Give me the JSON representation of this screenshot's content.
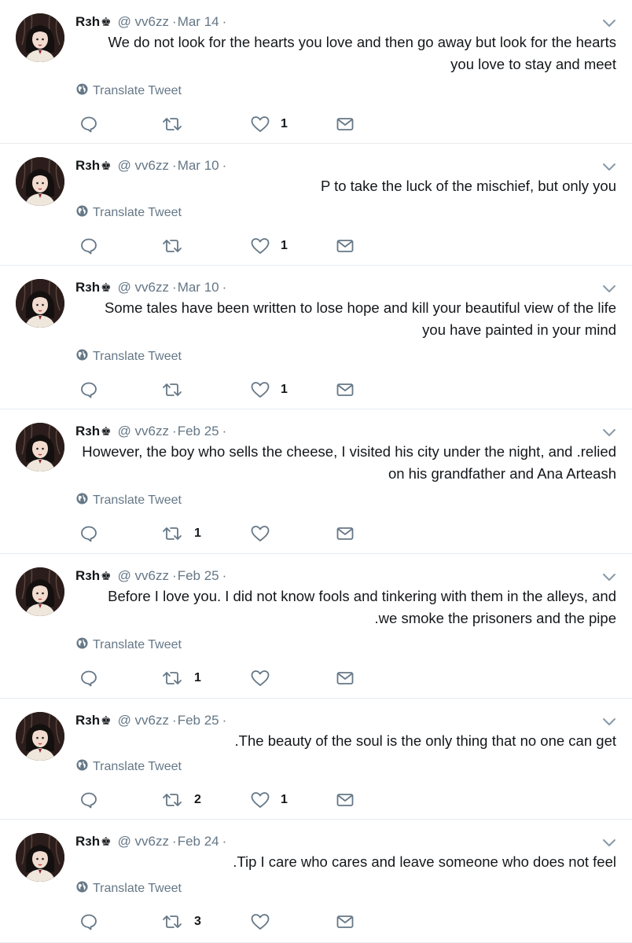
{
  "tweets": [
    {
      "name": "Rɜh",
      "handle": "@ vv6zz",
      "date": "Mar 14",
      "text": "We do not look for the hearts you love and then go away but look for the hearts you love to stay and meet",
      "translate": "Translate Tweet",
      "retweets": "",
      "likes": "1"
    },
    {
      "name": "Rɜh",
      "handle": "@ vv6zz",
      "date": "Mar 10",
      "text": "P to take the luck of the mischief, but only you",
      "translate": "Translate Tweet",
      "retweets": "",
      "likes": "1"
    },
    {
      "name": "Rɜh",
      "handle": "@ vv6zz",
      "date": "Mar 10",
      "text": "Some tales have been written to lose hope and kill your beautiful view of the life you have painted in your mind",
      "translate": "Translate Tweet",
      "retweets": "",
      "likes": "1"
    },
    {
      "name": "Rɜh",
      "handle": "@ vv6zz",
      "date": "Feb 25",
      "text": "However, the boy who sells the cheese, I visited his city under the night, and .relied on his grandfather and Ana Arteash",
      "translate": "Translate Tweet",
      "retweets": "1",
      "likes": ""
    },
    {
      "name": "Rɜh",
      "handle": "@ vv6zz",
      "date": "Feb 25",
      "text": "Before I love you. I did not know fools and tinkering with them in the alleys, and .we smoke the prisoners and the pipe",
      "translate": "Translate Tweet",
      "retweets": "1",
      "likes": ""
    },
    {
      "name": "Rɜh",
      "handle": "@ vv6zz",
      "date": "Feb 25",
      "text": ".The beauty of the soul is the only thing that no one can get",
      "translate": "Translate Tweet",
      "retweets": "2",
      "likes": "1"
    },
    {
      "name": "Rɜh",
      "handle": "@ vv6zz",
      "date": "Feb 24",
      "text": ".Tip I care who cares and leave someone who does not feel",
      "translate": "Translate Tweet",
      "retweets": "3",
      "likes": ""
    }
  ],
  "crown_icon": "♚",
  "colors": {
    "text": "#14171a",
    "muted": "#657786",
    "divider": "#e6ecf0"
  },
  "icons": [
    "avatar",
    "chevron-down-icon",
    "globe-icon",
    "reply-icon",
    "retweet-icon",
    "heart-icon",
    "envelope-icon"
  ]
}
